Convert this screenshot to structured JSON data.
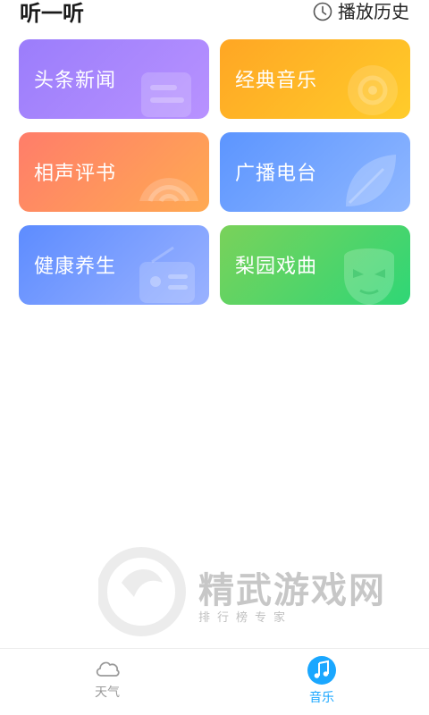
{
  "header": {
    "title": "听一听",
    "history_label": "播放历史"
  },
  "categories": [
    {
      "label": "头条新闻",
      "icon": "newspaper-icon",
      "color": "#a487fd"
    },
    {
      "label": "经典音乐",
      "icon": "disc-icon",
      "color": "#ffb726"
    },
    {
      "label": "相声评书",
      "icon": "fan-icon",
      "color": "#ff8f5f"
    },
    {
      "label": "广播电台",
      "icon": "leaf-icon",
      "color": "#72a4ff"
    },
    {
      "label": "健康养生",
      "icon": "radio-icon",
      "color": "#7a9eff"
    },
    {
      "label": "梨园戏曲",
      "icon": "opera-mask-icon",
      "color": "#4fd46a"
    }
  ],
  "watermark": {
    "title": "精武游戏网",
    "subtitle": "排行榜专家"
  },
  "tabbar": {
    "tabs": [
      {
        "label": "天气",
        "icon": "cloud-icon",
        "active": false
      },
      {
        "label": "音乐",
        "icon": "music-note-icon",
        "active": true
      }
    ],
    "active_color": "#1aa7ff",
    "inactive_color": "#999999"
  }
}
